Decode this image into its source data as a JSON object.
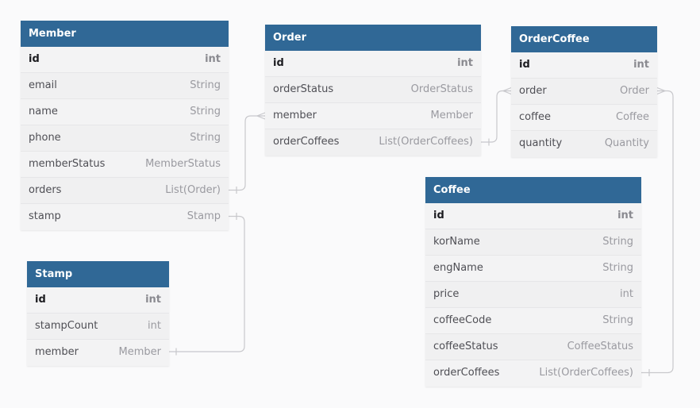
{
  "diagram": {
    "tables": [
      {
        "id": "member",
        "name": "Member",
        "fields": [
          {
            "name": "id",
            "type": "int",
            "pk": true
          },
          {
            "name": "email",
            "type": "String"
          },
          {
            "name": "name",
            "type": "String"
          },
          {
            "name": "phone",
            "type": "String"
          },
          {
            "name": "memberStatus",
            "type": "MemberStatus"
          },
          {
            "name": "orders",
            "type": "List(Order)"
          },
          {
            "name": "stamp",
            "type": "Stamp"
          }
        ]
      },
      {
        "id": "order",
        "name": "Order",
        "fields": [
          {
            "name": "id",
            "type": "int",
            "pk": true
          },
          {
            "name": "orderStatus",
            "type": "OrderStatus"
          },
          {
            "name": "member",
            "type": "Member"
          },
          {
            "name": "orderCoffees",
            "type": "List(OrderCoffees)"
          }
        ]
      },
      {
        "id": "ordercoffee",
        "name": "OrderCoffee",
        "fields": [
          {
            "name": "id",
            "type": "int",
            "pk": true
          },
          {
            "name": "order",
            "type": "Order"
          },
          {
            "name": "coffee",
            "type": "Coffee"
          },
          {
            "name": "quantity",
            "type": "Quantity"
          }
        ]
      },
      {
        "id": "stamp",
        "name": "Stamp",
        "fields": [
          {
            "name": "id",
            "type": "int",
            "pk": true
          },
          {
            "name": "stampCount",
            "type": "int"
          },
          {
            "name": "member",
            "type": "Member"
          }
        ]
      },
      {
        "id": "coffee",
        "name": "Coffee",
        "fields": [
          {
            "name": "id",
            "type": "int",
            "pk": true
          },
          {
            "name": "korName",
            "type": "String"
          },
          {
            "name": "engName",
            "type": "String"
          },
          {
            "name": "price",
            "type": "int"
          },
          {
            "name": "coffeeCode",
            "type": "String"
          },
          {
            "name": "coffeeStatus",
            "type": "CoffeeStatus"
          },
          {
            "name": "orderCoffees",
            "type": "List(OrderCoffees)"
          }
        ]
      }
    ],
    "relations": [
      {
        "from": "member.orders",
        "to": "order.member",
        "from_end": "one",
        "to_end": "many"
      },
      {
        "from": "member.stamp",
        "to": "stamp.member",
        "from_end": "one",
        "to_end": "one"
      },
      {
        "from": "order.orderCoffees",
        "to": "ordercoffee.order",
        "from_end": "one",
        "to_end": "many"
      },
      {
        "from": "coffee.orderCoffees",
        "to": "ordercoffee.order",
        "from_end": "one",
        "to_end": "many"
      }
    ],
    "colors": {
      "header": "#306896",
      "header_text": "#ffffff",
      "connector": "#c8c8cc",
      "background": "#fafafb"
    }
  }
}
